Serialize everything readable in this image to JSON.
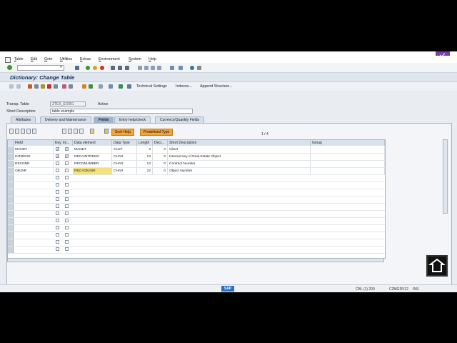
{
  "menu": [
    "Table",
    "Edit",
    "Goto",
    "Utilities",
    "Extras",
    "Environment",
    "System",
    "Help"
  ],
  "title": "Dictionary: Change Table",
  "app_toolbar": {
    "technical_settings": "Technical Settings",
    "indexes": "Indexes...",
    "append_structure": "Append Structure..."
  },
  "header": {
    "transp_table_label": "Transp. Table",
    "transp_table_value": "ZTEX_EX001",
    "status": "Active",
    "short_desc_label": "Short Description",
    "short_desc_value": "table example"
  },
  "tabs": [
    "Attributes",
    "Delivery and Maintenance",
    "Fields",
    "Entry help/check",
    "Currency/Quantity Fields"
  ],
  "active_tab": "Fields",
  "grid_toolbar": {
    "srch_help": "Srch Help",
    "predefined_type": "Predefined Type",
    "pager": "1 / 4"
  },
  "columns": [
    "Field",
    "Key",
    "Ini...",
    "Data element",
    "Data Type",
    "Length",
    "Deci...",
    "Short Description",
    "Group"
  ],
  "rows": [
    {
      "field": "MANDT",
      "key": "✓",
      "ini": "✓",
      "data_element": "MANDT",
      "data_type": "CLNT",
      "length": "3",
      "deci": "0",
      "desc": "Client"
    },
    {
      "field": "INTRENO",
      "key": "✓",
      "ini": "✓",
      "data_element": "RECAINTRENO",
      "data_type": "CHAR",
      "length": "13",
      "deci": "0",
      "desc": "Internal Key of Real Estate Object"
    },
    {
      "field": "RECNNR",
      "key": "",
      "ini": "",
      "data_element": "RECNNUMBER",
      "data_type": "CHAR",
      "length": "13",
      "deci": "0",
      "desc": "Contract Number"
    },
    {
      "field": "OBJNR",
      "key": "",
      "ini": "",
      "data_element": "RECAOBJNR",
      "data_type": "CHAR",
      "length": "22",
      "deci": "0",
      "desc": "Object Number"
    }
  ],
  "status_bar": {
    "logo": "SAP",
    "system": "CBL (1) 200",
    "server": "C2MGRV12",
    "mode": "INS"
  }
}
